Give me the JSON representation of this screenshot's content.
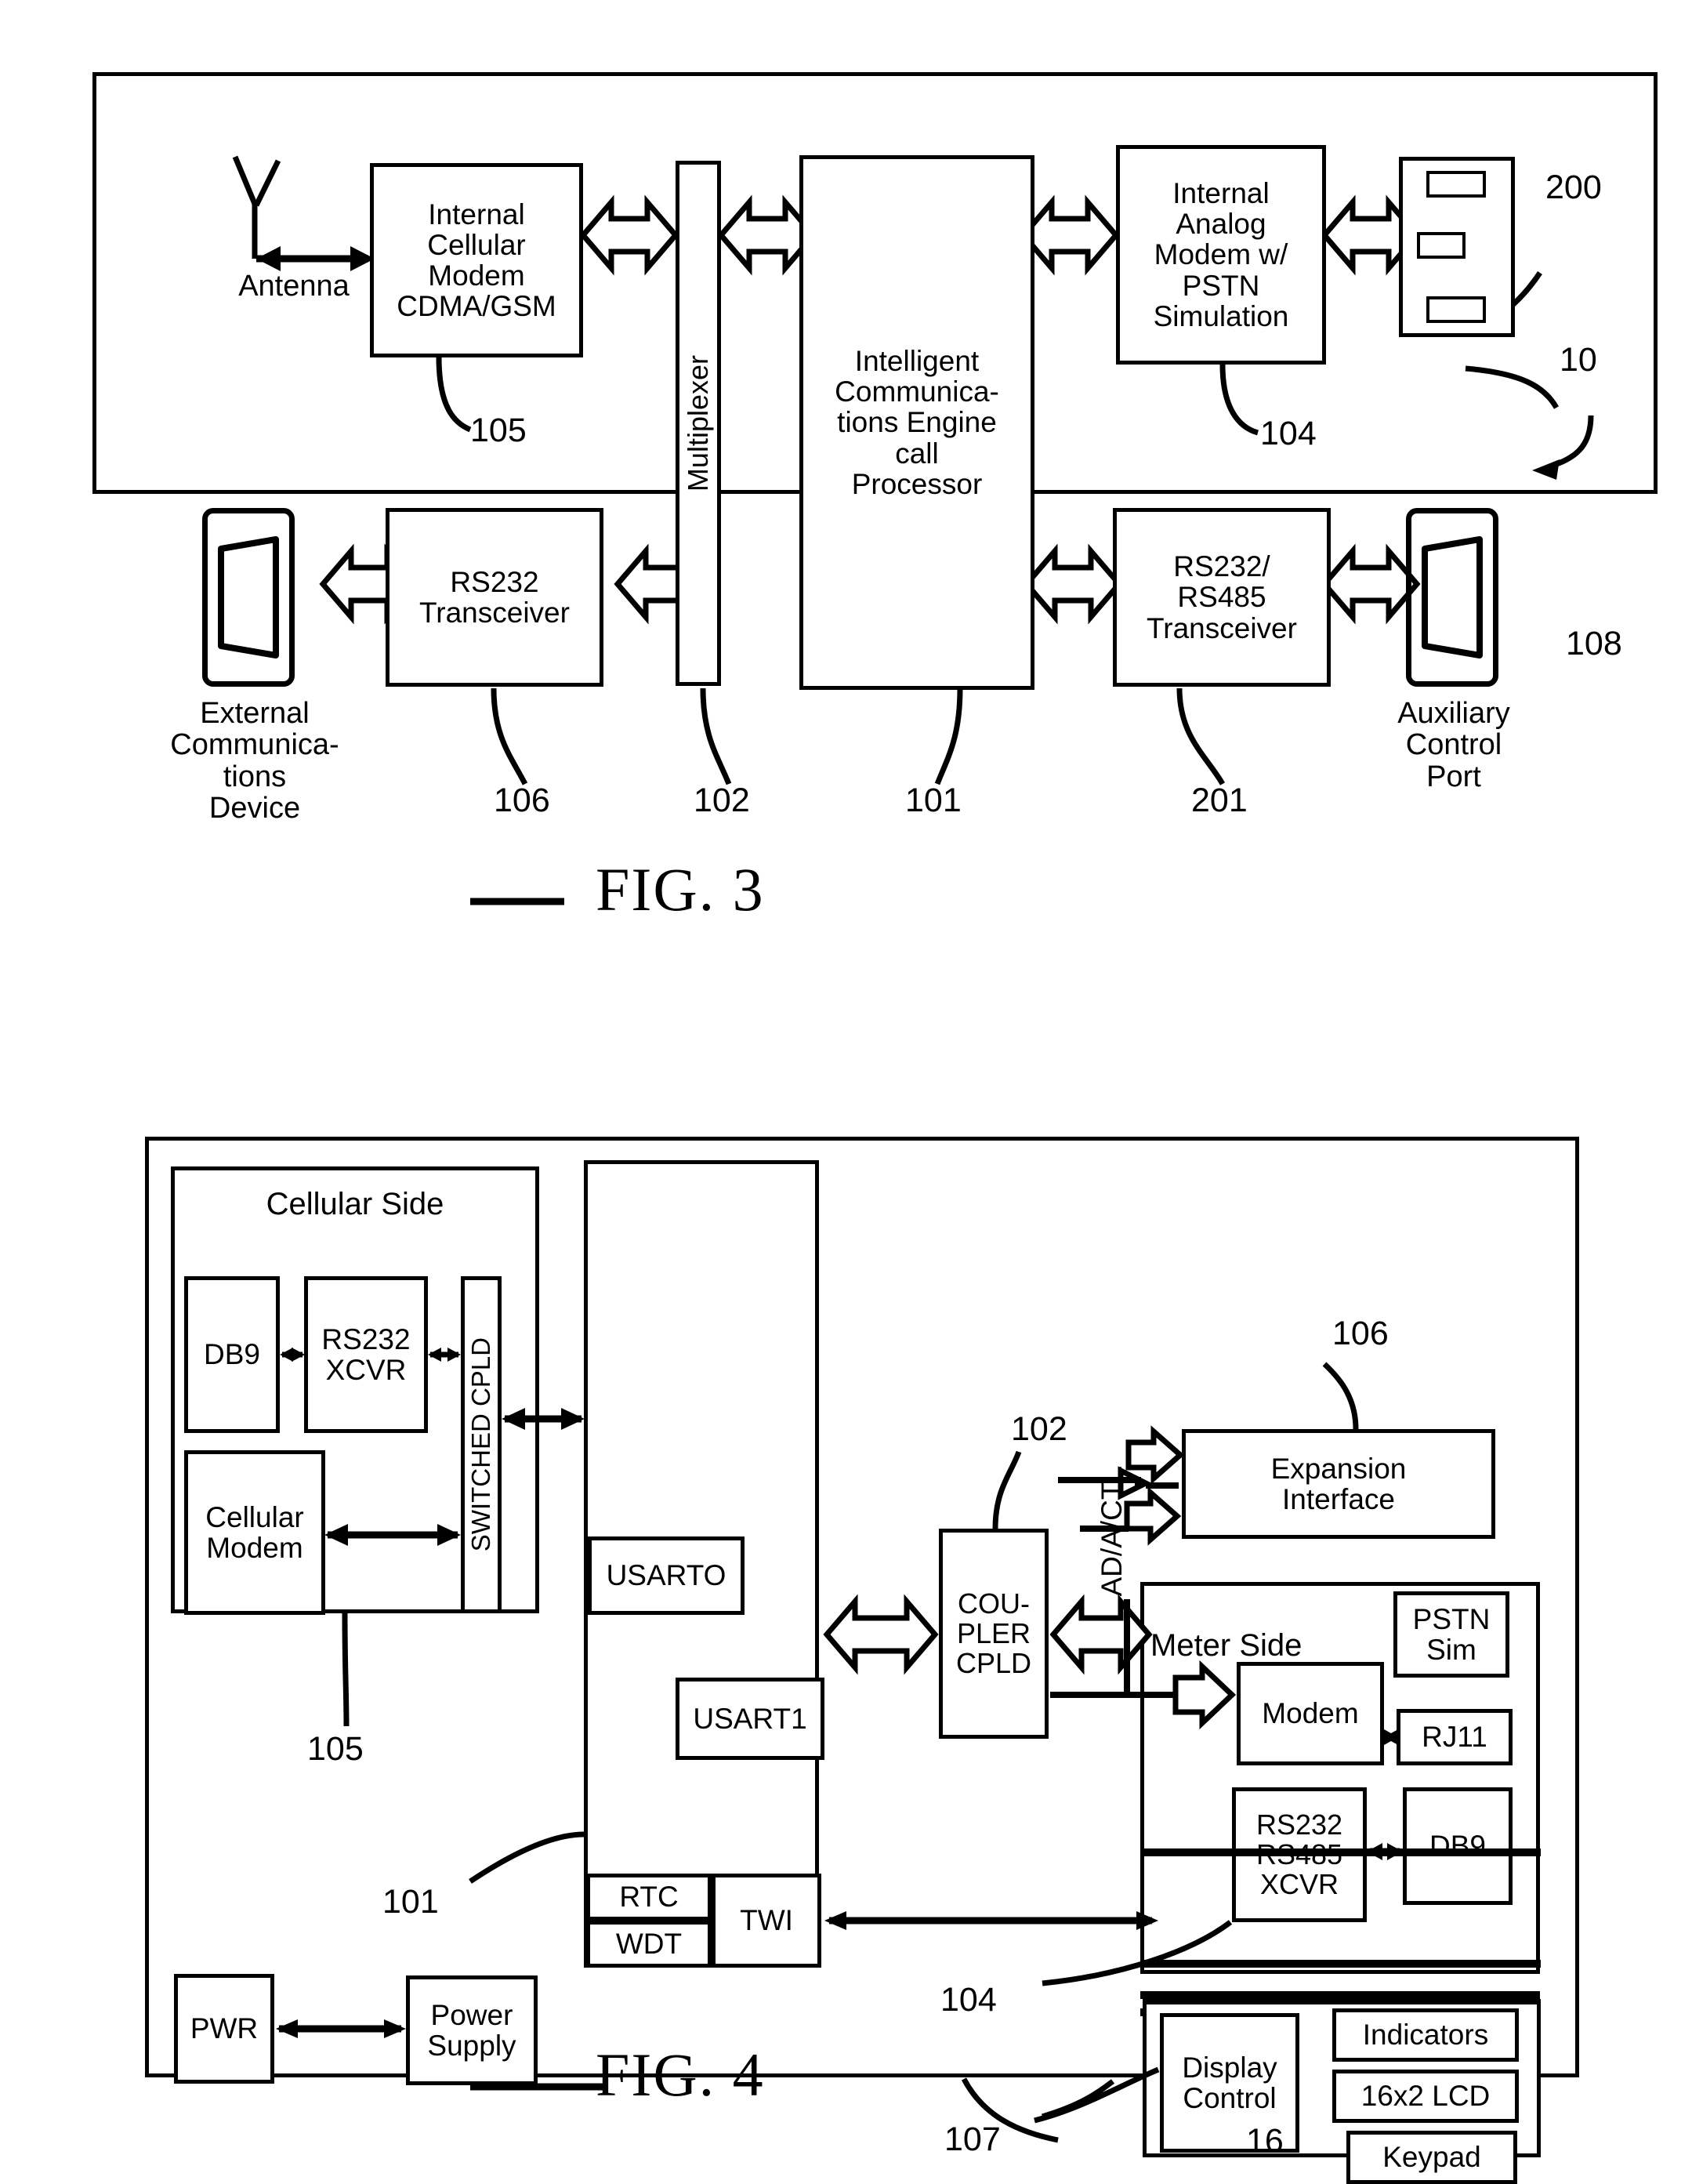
{
  "figure3": {
    "caption": "FIG. 3",
    "outer_ref": "10",
    "blocks": {
      "antenna_label": "Antenna",
      "internal_cellular_modem": "Internal\nCellular\nModem\nCDMA/GSM",
      "multiplexer": "Multiplexer",
      "engine": "Intelligent\nCommunica-\ntions Engine\ncall\nProcessor",
      "internal_analog_modem": "Internal\nAnalog\nModem w/\nPSTN\nSimulation",
      "rs232_transceiver": "RS232\nTransceiver",
      "rs232_rs485_transceiver": "RS232/\nRS485\nTransceiver",
      "external_comm_device": "External\nCommunica-\ntions\nDevice",
      "auxiliary_control_port": "Auxiliary\nControl\nPort"
    },
    "refs": {
      "cellular_modem": "105",
      "analog_modem": "104",
      "rj_jack_block": "200",
      "rs232_transceiver": "106",
      "multiplexer": "102",
      "engine": "101",
      "rs485_transceiver": "201",
      "aux_port": "108",
      "device": "10"
    }
  },
  "figure4": {
    "caption": "FIG. 4",
    "outer_ref": "16",
    "blocks": {
      "cellular_side": "Cellular Side",
      "db9_left": "DB9",
      "rs232_xcvr": "RS232\nXCVR",
      "switched_cpld": "SWITCHED CPLD",
      "cellular_modem": "Cellular\nModem",
      "usart0": "USARTO",
      "usart1": "USART1",
      "rtc": "RTC",
      "wdt": "WDT",
      "twi": "TWI",
      "coupler_cpld": "COU-\nPLER\nCPLD",
      "ad_a_ctl": "AD/A/CTL",
      "expansion_interface": "Expansion\nInterface",
      "meter_side": "Meter Side",
      "pstn_sim": "PSTN\nSim",
      "modem": "Modem",
      "rj11": "RJ11",
      "rs232_rs485_xcvr": "RS232\nRS485\nXCVR",
      "db9_right": "DB9",
      "display_control": "Display\nControl",
      "indicators": "Indicators",
      "lcd": "16x2 LCD",
      "keypad": "Keypad",
      "pwr": "PWR",
      "power_supply": "Power\nSupply"
    },
    "refs": {
      "expansion_interface": "106",
      "coupler_cpld": "102",
      "cellular_side": "105",
      "cpu": "101",
      "meter_side": "104",
      "display": "107",
      "device": "16"
    }
  },
  "colors": {
    "ink": "#000000",
    "paper": "#ffffff"
  }
}
